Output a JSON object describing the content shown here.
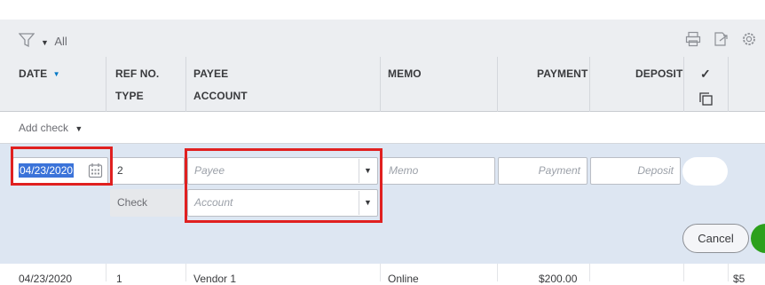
{
  "toolbar": {
    "filter_label": "All",
    "icons": [
      "filter-icon",
      "print-icon",
      "export-icon",
      "settings-icon"
    ]
  },
  "columns": {
    "date": "DATE",
    "refno": "REF NO.",
    "type": "TYPE",
    "payee": "PAYEE",
    "account": "ACCOUNT",
    "memo": "MEMO",
    "payment": "PAYMENT",
    "deposit": "DEPOSIT",
    "check": "✓"
  },
  "add_check": {
    "label": "Add check"
  },
  "edit_row": {
    "date": "04/23/2020",
    "ref_no": "2",
    "type": "Check",
    "payee_placeholder": "Payee",
    "account_placeholder": "Account",
    "memo_placeholder": "Memo",
    "payment_placeholder": "Payment",
    "deposit_placeholder": "Deposit",
    "cancel_label": "Cancel"
  },
  "rows": [
    {
      "date": "04/23/2020",
      "ref_no": "1",
      "payee": "Vendor 1",
      "memo": "Online",
      "payment": "$200.00",
      "balance": "$5"
    }
  ],
  "colors": {
    "highlight": "#e02020",
    "selection": "#3b73d9",
    "save_green": "#2ca01c",
    "header_bg": "#eceef1",
    "edit_bg": "#dde6f2"
  }
}
